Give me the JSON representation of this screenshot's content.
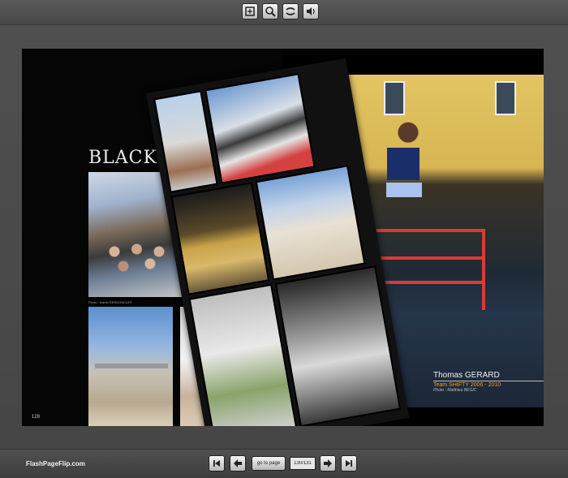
{
  "toolbar": {
    "buttons": [
      {
        "name": "fit-page",
        "icon": "fit-page-icon"
      },
      {
        "name": "zoom",
        "icon": "magnifier-icon"
      },
      {
        "name": "fullscreen",
        "icon": "flip-icon"
      },
      {
        "name": "sound",
        "icon": "speaker-icon"
      }
    ]
  },
  "book": {
    "left_page": {
      "title": "BLACKRI",
      "photo_credit": "Photo : Martin KERDONCUFF",
      "page_number": "128"
    },
    "right_page": {
      "rider_name": "Thomas GERARD",
      "team": "Team SHIFTY 2006 - 2010",
      "photo_credit": "Photo : Matthieu BEGIC"
    }
  },
  "footer": {
    "brand": "FlashPageFlip.com",
    "goto_label": "go to page",
    "page_indicator": "130/131"
  }
}
